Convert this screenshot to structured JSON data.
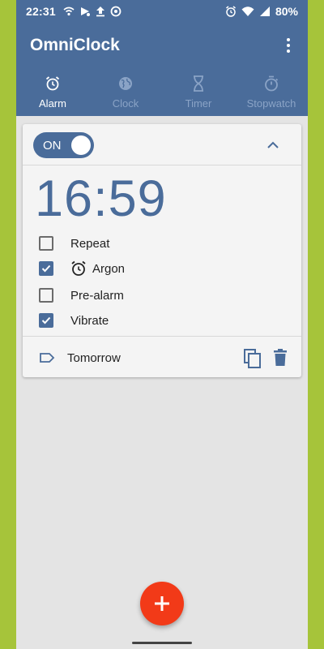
{
  "statusbar": {
    "time": "22:31",
    "battery": "80%"
  },
  "app": {
    "title": "OmniClock"
  },
  "tabs": [
    {
      "label": "Alarm",
      "icon": "alarm-clock-icon",
      "active": true
    },
    {
      "label": "Clock",
      "icon": "globe-icon",
      "active": false
    },
    {
      "label": "Timer",
      "icon": "hourglass-icon",
      "active": false
    },
    {
      "label": "Stopwatch",
      "icon": "stopwatch-icon",
      "active": false
    }
  ],
  "alarm": {
    "toggle_label": "ON",
    "enabled": true,
    "time": "16:59",
    "options": [
      {
        "label": "Repeat",
        "checked": false
      },
      {
        "label": "Argon",
        "checked": true,
        "icon": "alarm-clock-icon"
      },
      {
        "label": "Pre-alarm",
        "checked": false
      },
      {
        "label": "Vibrate",
        "checked": true
      }
    ],
    "label": "Tomorrow"
  },
  "colors": {
    "primary": "#4a6c9a",
    "accent": "#f23a18",
    "background": "#e4e4e4",
    "frame": "#a6c43a"
  }
}
